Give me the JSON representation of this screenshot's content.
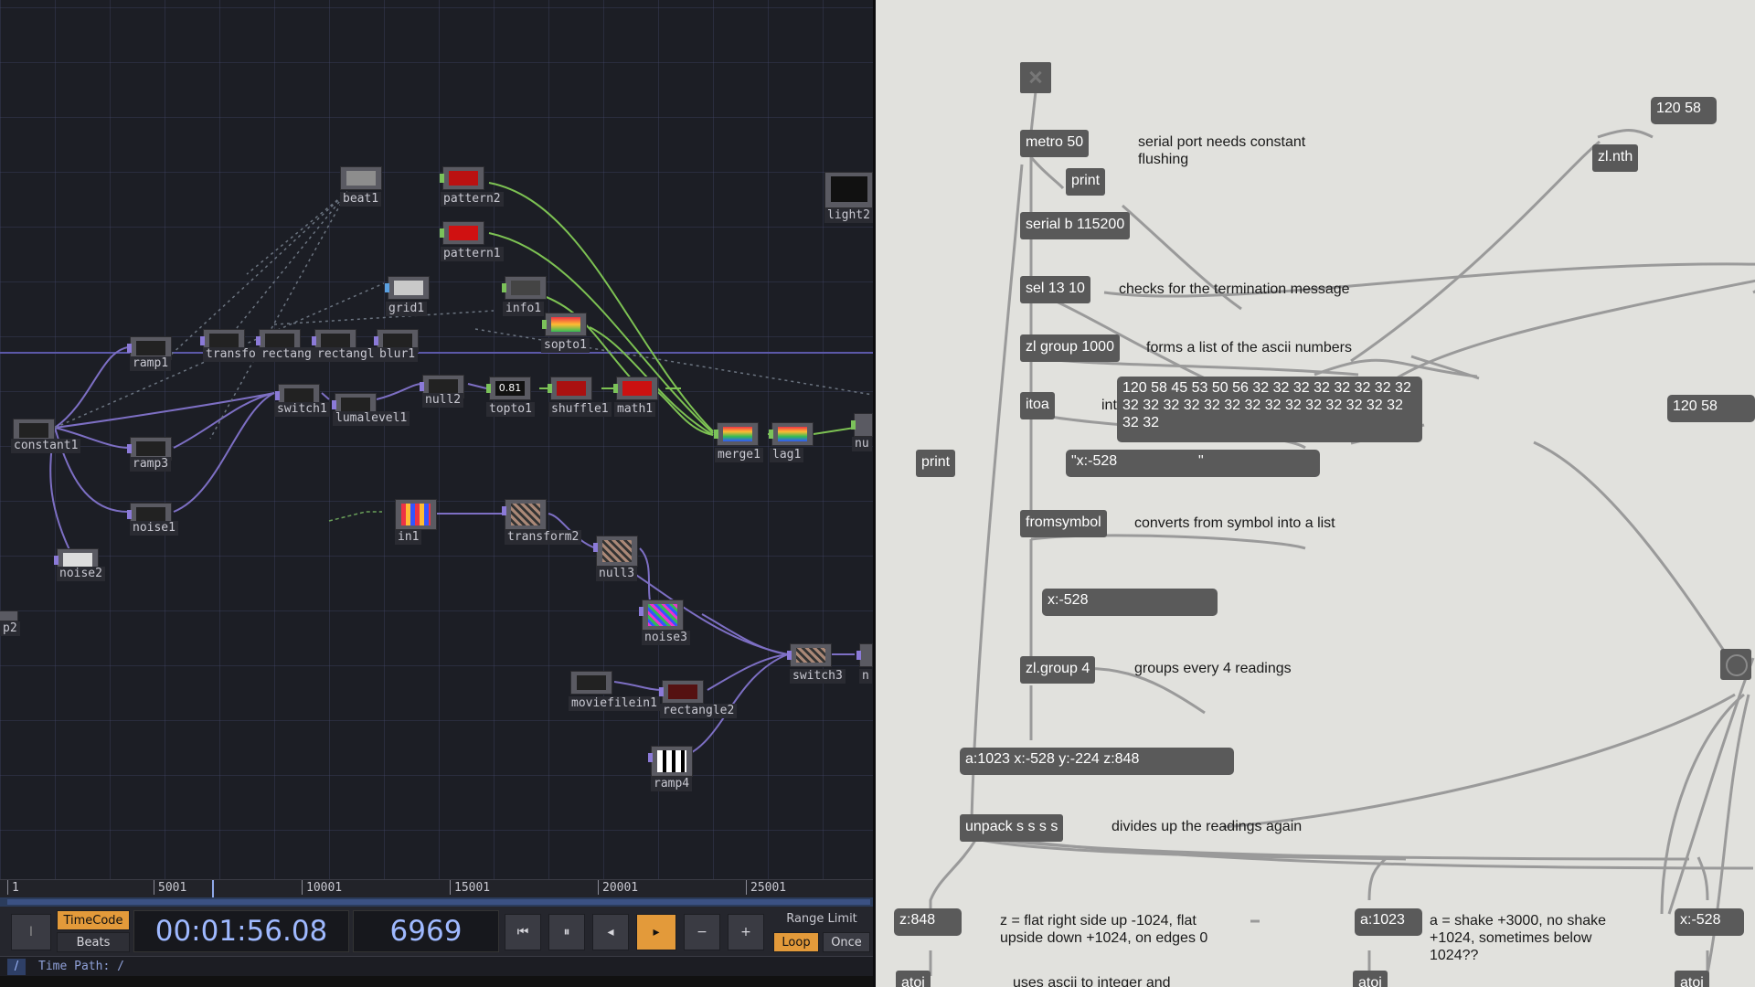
{
  "touchdesigner": {
    "operators": [
      {
        "id": "beat1",
        "label": "beat1"
      },
      {
        "id": "pattern2",
        "label": "pattern2"
      },
      {
        "id": "pattern1",
        "label": "pattern1"
      },
      {
        "id": "light2",
        "label": "light2"
      },
      {
        "id": "grid1",
        "label": "grid1"
      },
      {
        "id": "info1",
        "label": "info1"
      },
      {
        "id": "sopto1",
        "label": "sopto1"
      },
      {
        "id": "ramp1",
        "label": "ramp1"
      },
      {
        "id": "transform1",
        "label": "transfo"
      },
      {
        "id": "rectangle1",
        "label": "rectang"
      },
      {
        "id": "rectangle3",
        "label": "rectangl"
      },
      {
        "id": "blur1",
        "label": "blur1"
      },
      {
        "id": "null2",
        "label": "null2"
      },
      {
        "id": "topto1",
        "label": "topto1"
      },
      {
        "id": "shuffle1",
        "label": "shuffle1"
      },
      {
        "id": "math1",
        "label": "math1"
      },
      {
        "id": "switch1",
        "label": "switch1"
      },
      {
        "id": "lumalevel1",
        "label": "lumalevel1"
      },
      {
        "id": "constant1",
        "label": "constant1"
      },
      {
        "id": "ramp3",
        "label": "ramp3"
      },
      {
        "id": "merge1",
        "label": "merge1"
      },
      {
        "id": "lag1",
        "label": "lag1"
      },
      {
        "id": "nu",
        "label": "nu"
      },
      {
        "id": "noise1",
        "label": "noise1"
      },
      {
        "id": "in1",
        "label": "in1"
      },
      {
        "id": "transform2",
        "label": "transform2"
      },
      {
        "id": "null3",
        "label": "null3"
      },
      {
        "id": "noise2",
        "label": "noise2"
      },
      {
        "id": "p2",
        "label": "p2"
      },
      {
        "id": "noise3",
        "label": "noise3"
      },
      {
        "id": "switch3",
        "label": "switch3"
      },
      {
        "id": "n",
        "label": "n"
      },
      {
        "id": "moviefilein1",
        "label": "moviefilein1"
      },
      {
        "id": "rectangle2",
        "label": "rectangle2"
      },
      {
        "id": "ramp4",
        "label": "ramp4"
      }
    ],
    "topto1_value": "0.81",
    "timeline_ticks": [
      "1",
      "5001",
      "10001",
      "15001",
      "20001",
      "25001"
    ],
    "transport": {
      "timecode_label": "TimeCode",
      "beats_label": "Beats",
      "timecode": "00:01:56.08",
      "frame": "6969",
      "range_limit_label": "Range Limit",
      "loop_label": "Loop",
      "once_label": "Once",
      "minus_label": "−",
      "plus_label": "+",
      "i_label": "I"
    },
    "time_path_prefix": "/",
    "time_path": "Time Path: /",
    "colors": {
      "accent_orange": "#e39a3a",
      "timecode_blue": "#9fb9ff",
      "wire_green": "#7dc253",
      "wire_purple": "#7d6fc4"
    }
  },
  "max_patch": {
    "objects": {
      "metro": "metro 50",
      "print1": "print",
      "serial": "serial b 115200",
      "sel": "sel 13 10",
      "zlgroup1000": "zl group 1000",
      "itoa": "itoa",
      "print2": "print",
      "fromsymbol": "fromsymbol",
      "zlgroup4": "zl.group 4",
      "unpack": "unpack s s s s",
      "zlnth": "zl.nth",
      "atoi1": "atoi",
      "atoi2": "atoi",
      "atoi3": "atoi"
    },
    "messages": {
      "m120_58_top": "120 58",
      "ascii_list": "120 58 45 53 50 56 32 32 32 32 32 32 32 32 32 32 32 32 32 32 32 32 32 32 32 32 32 32 32 32",
      "xsym": "\"x:-528                    \"",
      "m120_58_right": "120 58",
      "x528": "x:-528",
      "readings": "a:1023 x:-528 y:-224 z:848",
      "z848": "z:848",
      "a1023": "a:1023",
      "x528b": "x:-528"
    },
    "comments": {
      "serial_flush": "serial port needs constant flushing",
      "termination": "checks for the termination message",
      "ascii_list": "forms a list of the ascii numbers",
      "int_ascii": "integer to ascii",
      "fromsymbol": "converts from symbol into a list",
      "groups4": "groups every 4 readings",
      "divides": "divides up the readings again",
      "z_note": "z = flat right side up -1024, flat upside down +1024, on edges 0",
      "a_note": "a = shake +3000, no shake +1024, sometimes below 1024??",
      "uses_ascii": "uses ascii to integer and"
    },
    "colors": {
      "background": "#e1e1dd",
      "object": "#595959",
      "cord": "#9a9a9a"
    }
  }
}
